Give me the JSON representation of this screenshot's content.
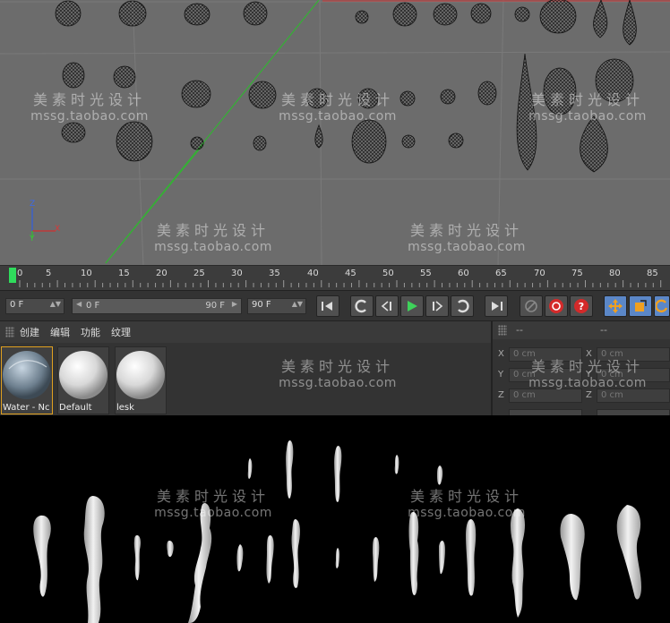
{
  "timeline": {
    "ticks": [
      "0",
      "5",
      "10",
      "15",
      "20",
      "25",
      "30",
      "35",
      "40",
      "45",
      "50",
      "55",
      "60",
      "65",
      "70",
      "75",
      "80",
      "85"
    ]
  },
  "transport": {
    "start_field": "0 F",
    "slider_left": "0 F",
    "slider_right": "90 F",
    "end_field": "90 F"
  },
  "material_manager": {
    "menu": [
      "创建",
      "编辑",
      "功能",
      "纹理"
    ],
    "materials": [
      "Water - Nc",
      "Default",
      "lesk"
    ]
  },
  "coordinates": {
    "header_left": "--",
    "header_right": "--",
    "rows": [
      {
        "axis": "X",
        "value": "0 cm",
        "axis2": "X",
        "value2": "0 cm"
      },
      {
        "axis": "Y",
        "value": "0 cm",
        "axis2": "Y",
        "value2": "0 cm"
      },
      {
        "axis": "Z",
        "value": "0 cm",
        "axis2": "Z",
        "value2": "0 cm"
      }
    ]
  },
  "viewport_axes": {
    "z": "Z",
    "y": "Y",
    "x": "X"
  },
  "watermark": {
    "line1": "美素时光设计",
    "line2": "mssg.taobao.com"
  },
  "colors": {
    "playhead": "#2fdc5c",
    "axis_x": "#d03030",
    "axis_y": "#30c030",
    "axis_z": "#3060e0",
    "selected_material": "#e0a020"
  }
}
